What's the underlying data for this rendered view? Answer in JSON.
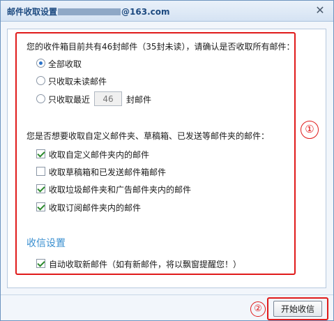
{
  "window": {
    "title_prefix": "邮件收取设置",
    "title_suffix": "@163.com",
    "close_glyph": "✕"
  },
  "receive_all": {
    "prompt": "您的收件箱目前共有46封邮件（35封未读），请确认是否收取所有邮件：",
    "options": [
      {
        "label": "全部收取",
        "checked": true
      },
      {
        "label": "只收取未读邮件",
        "checked": false
      },
      {
        "label": "只收取最近",
        "checked": false
      }
    ],
    "recent_count": "46",
    "recent_unit": "封邮件"
  },
  "folders": {
    "prompt": "您是否想要收取自定义邮件夹、草稿箱、已发送等邮件夹的邮件：",
    "items": [
      {
        "label": "收取自定义邮件夹内的邮件",
        "checked": true
      },
      {
        "label": "收取草稿箱和已发送邮件箱邮件",
        "checked": false
      },
      {
        "label": "收取垃圾邮件夹和广告邮件夹内的邮件",
        "checked": true
      },
      {
        "label": "收取订阅邮件夹内的邮件",
        "checked": true
      }
    ]
  },
  "receive_settings": {
    "title": "收信设置",
    "auto_receive": {
      "label": "自动收取新邮件（如有新邮件，将以飘窗提醒您！）",
      "checked": true
    }
  },
  "footer": {
    "start_button": "开始收信"
  },
  "annotations": {
    "marker1": "①",
    "marker2": "②",
    "color": "#e01a1a"
  },
  "colors": {
    "accent": "#3a8fd0",
    "title_text": "#1d4a80"
  }
}
